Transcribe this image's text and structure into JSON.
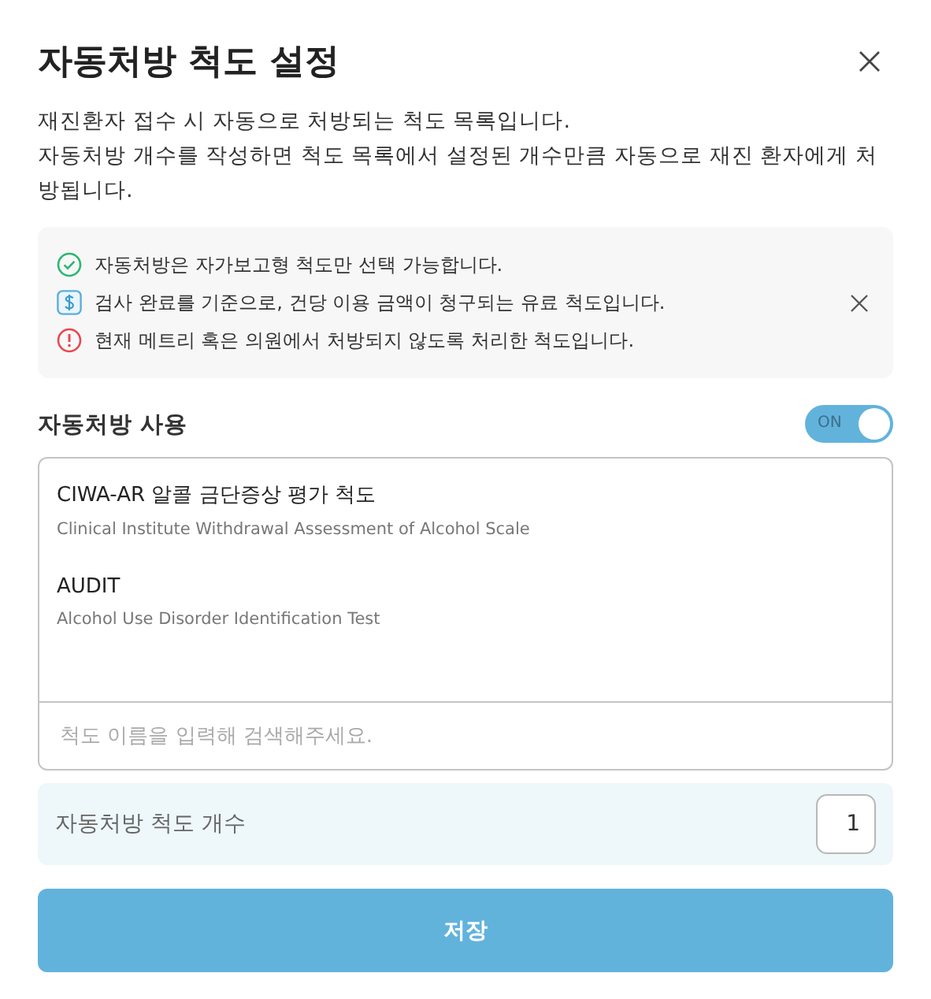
{
  "title": "자동처방 척도 설정",
  "description": [
    "재진환자 접수 시 자동으로 처방되는 척도 목록입니다.",
    "자동처방 개수를 작성하면 척도 목록에서 설정된 개수만큼 자동으로 재진 환자에게 처방됩니다."
  ],
  "notices": [
    {
      "kind": "check",
      "text": "자동처방은 자가보고형 척도만 선택 가능합니다."
    },
    {
      "kind": "dollar",
      "text": "검사 완료를 기준으로, 건당 이용 금액이 청구되는 유료 척도입니다."
    },
    {
      "kind": "alert",
      "text": "현재 메트리 혹은 의원에서 처방되지 않도록 처리한 척도입니다."
    }
  ],
  "auto_prescription": {
    "label": "자동처방 사용",
    "on": true,
    "toggle_text": "ON"
  },
  "scales": [
    {
      "name": "CIWA-AR 알콜 금단증상 평가 척도",
      "subtitle": "Clinical Institute Withdrawal Assessment of Alcohol Scale"
    },
    {
      "name": "AUDIT",
      "subtitle": "Alcohol Use Disorder Identification Test"
    }
  ],
  "search": {
    "placeholder": "척도 이름을 입력해 검색해주세요."
  },
  "count": {
    "label": "자동처방 척도 개수",
    "value": "1"
  },
  "save_button": "저장"
}
